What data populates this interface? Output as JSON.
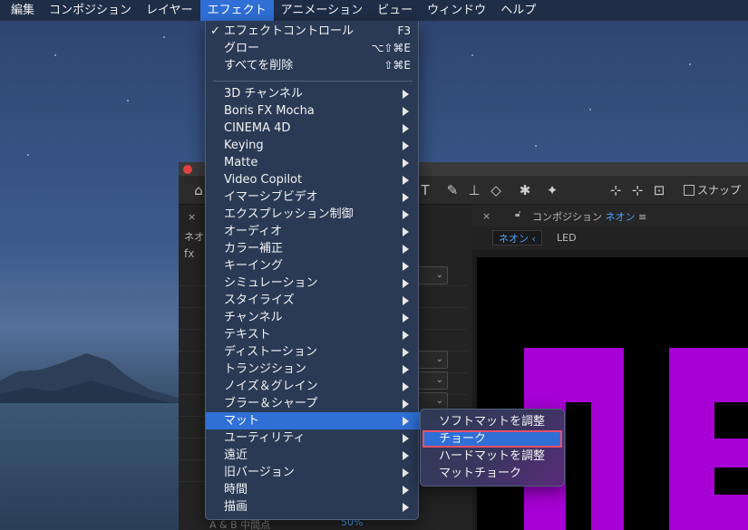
{
  "menubar": {
    "items": [
      "編集",
      "コンポジション",
      "レイヤー",
      "エフェクト",
      "アニメーション",
      "ビュー",
      "ウィンドウ",
      "ヘルプ"
    ],
    "active_index": 3
  },
  "effect_menu": {
    "top_items": [
      {
        "label": "エフェクトコントロール",
        "checked": true,
        "shortcut": "F3"
      },
      {
        "label": "グロー",
        "checked": false,
        "shortcut": "⌥⇧⌘E"
      },
      {
        "label": "すべてを削除",
        "checked": false,
        "shortcut": "⇧⌘E"
      }
    ],
    "categories": [
      "3D チャンネル",
      "Boris FX Mocha",
      "CINEMA 4D",
      "Keying",
      "Matte",
      "Video Copilot",
      "イマーシブビデオ",
      "エクスプレッション制御",
      "オーディオ",
      "カラー補正",
      "キーイング",
      "シミュレーション",
      "スタイライズ",
      "チャンネル",
      "テキスト",
      "ディストーション",
      "トランジション",
      "ノイズ＆グレイン",
      "ブラー＆シャープ",
      "マット",
      "ユーティリティ",
      "遠近",
      "旧バージョン",
      "時間",
      "描画"
    ],
    "selected_category": "マット"
  },
  "submenu": {
    "items": [
      "ソフトマットを調整",
      "チョーク",
      "ハードマットを調整",
      "マットチョーク"
    ],
    "selected_index": 1
  },
  "toolbar": {
    "snap_label": "スナップ"
  },
  "left_panel": {
    "header_fragment": "ネオ",
    "fx_fragment": "fx",
    "bottom_text": "A & B 中間点",
    "percent": "50%"
  },
  "comp_panel": {
    "title_prefix": "コンポジション",
    "title_name": "ネオン",
    "breadcrumb_active": "ネオン",
    "breadcrumb_next": "LED"
  },
  "colors": {
    "menubar_bg": "#1f2d47",
    "selection": "#2f6fd6",
    "highlight_outline": "#e8506a",
    "neon": "#b000e0"
  }
}
